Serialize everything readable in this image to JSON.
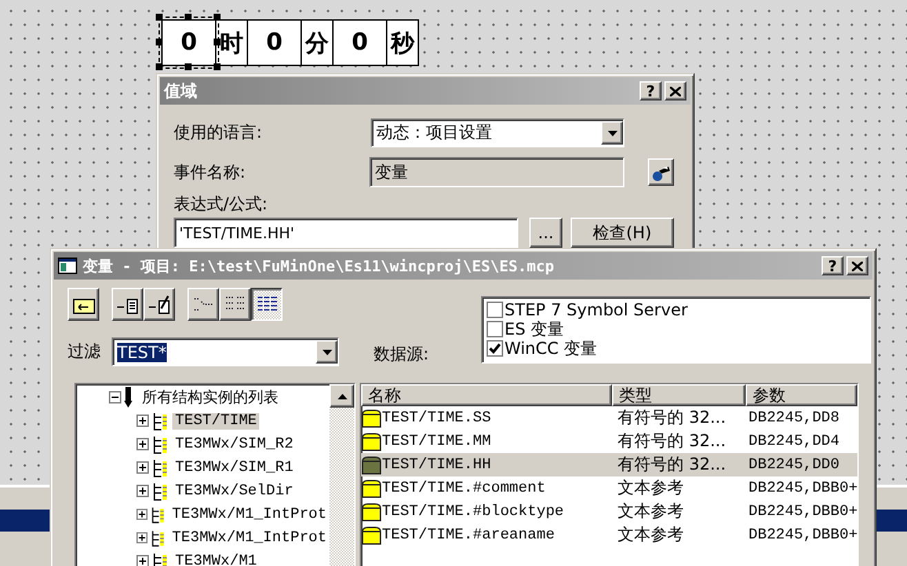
{
  "time_display": {
    "fields": [
      {
        "kind": "value",
        "text": "0",
        "selected": true
      },
      {
        "kind": "unit",
        "text": "时",
        "selected": false
      },
      {
        "kind": "value",
        "text": "0",
        "selected": false
      },
      {
        "kind": "unit",
        "text": "分",
        "selected": false
      },
      {
        "kind": "value",
        "text": "0",
        "selected": false
      },
      {
        "kind": "unit",
        "text": "秒",
        "selected": false
      }
    ]
  },
  "range_dialog": {
    "title": "值域",
    "help_button": "?",
    "language_label": "使用的语言:",
    "language_value": "动态：项目设置",
    "event_label": "事件名称:",
    "event_value": "变量",
    "expression_label": "表达式/公式:",
    "expression_value": "'TEST/TIME.HH'",
    "browse_button": "...",
    "check_button": "检查(H)"
  },
  "tag_dialog": {
    "title": "变量 - 项目: E:\\test\\FuMinOne\\Es11\\wincproj\\ES\\ES.mcp",
    "help_button": "?",
    "toolbar": [
      {
        "pressed": false
      },
      {
        "pressed": false
      },
      {
        "pressed": false
      },
      {
        "pressed": false
      },
      {
        "pressed": false
      },
      {
        "pressed": true
      }
    ],
    "filter_label": "过滤",
    "filter_value": "TEST*",
    "data_source_label": "数据源:",
    "sources": [
      {
        "label": "STEP 7 Symbol Server",
        "checked": false
      },
      {
        "label": "ES 变量",
        "checked": false
      },
      {
        "label": "WinCC 变量",
        "checked": true
      }
    ],
    "tree": {
      "root": {
        "label": "所有结构实例的列表",
        "expanded": true,
        "children": [
          {
            "label": "TEST/TIME",
            "selected": true,
            "expanded": false
          },
          {
            "label": "TE3MWx/SIM_R2",
            "selected": false,
            "expanded": false
          },
          {
            "label": "TE3MWx/SIM_R1",
            "selected": false,
            "expanded": false
          },
          {
            "label": "TE3MWx/SelDir",
            "selected": false,
            "expanded": false
          },
          {
            "label": "TE3MWx/M1_IntProt",
            "selected": false,
            "expanded": false
          },
          {
            "label": "TE3MWx/M1_IntProt",
            "selected": false,
            "expanded": false
          },
          {
            "label": "TE3MWx/M1",
            "selected": false,
            "expanded": false
          }
        ]
      }
    },
    "table": {
      "columns": [
        "名称",
        "类型",
        "参数"
      ],
      "rows": [
        {
          "cells": [
            "TEST/TIME.SS",
            "有符号的 32...",
            "DB2245,DD8"
          ],
          "selected": false
        },
        {
          "cells": [
            "TEST/TIME.MM",
            "有符号的 32...",
            "DB2245,DD4"
          ],
          "selected": false
        },
        {
          "cells": [
            "TEST/TIME.HH",
            "有符号的 32...",
            "DB2245,DD0"
          ],
          "selected": true
        },
        {
          "cells": [
            "TEST/TIME.#comment",
            "文本参考",
            "DB2245,DBB0+"
          ],
          "selected": false
        },
        {
          "cells": [
            "TEST/TIME.#blocktype",
            "文本参考",
            "DB2245,DBB0+"
          ],
          "selected": false
        },
        {
          "cells": [
            "TEST/TIME.#areaname",
            "文本参考",
            "DB2245,DBB0+"
          ],
          "selected": false
        }
      ]
    }
  }
}
